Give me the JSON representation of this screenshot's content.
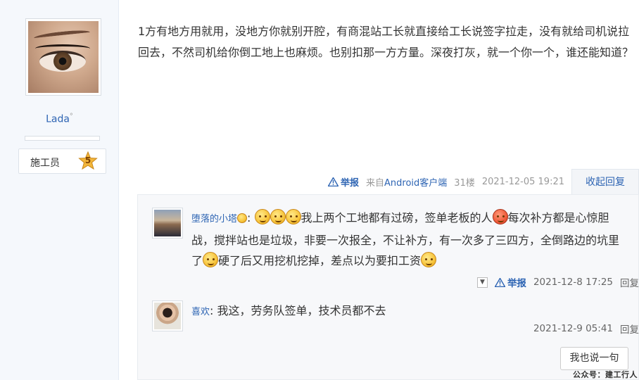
{
  "author": {
    "username": "Lada",
    "username_mark": "°",
    "rank_title": "施工员",
    "rank_level": "5"
  },
  "post": {
    "body": "1方有地方用就用，没地方你就别开腔，有商混站工长就直接给工长说签字拉走，没有就给司机说拉回去，不然司机给你倒工地上也麻烦。也别扣那一方方量。深夜打灰，就一个你一个，谁还能知道？",
    "meta": {
      "report": "举报",
      "from_prefix": "来自",
      "client": "Android客户端",
      "floor": "31楼",
      "time": "2021-12-05 19:21"
    },
    "collapse_label": "收起回复"
  },
  "replies": [
    {
      "name": "堕落的小塔",
      "text_1": "我上两个工地都有过磅，签单老板的人",
      "text_2": "每次补方都是心惊胆战，搅拌站也是垃圾，非要一次报全，不让补方，有一次多了三四方，全倒路边的坑里了",
      "text_3": "硬了后又用挖机挖掉，差点以为要扣工资",
      "report": "举报",
      "time": "2021-12-8 17:25",
      "reply_label": "回复"
    },
    {
      "name": "喜欢",
      "text": "我这，劳务队签单，技术员都不去",
      "time": "2021-12-9 05:41",
      "reply_label": "回复"
    }
  ],
  "say_button": "我也说一句",
  "watermark": "公众号：建工行人",
  "colors": {
    "link": "#2d64b3",
    "panel_bg": "#f7f8fa",
    "author_bg": "#f5f8fc"
  }
}
